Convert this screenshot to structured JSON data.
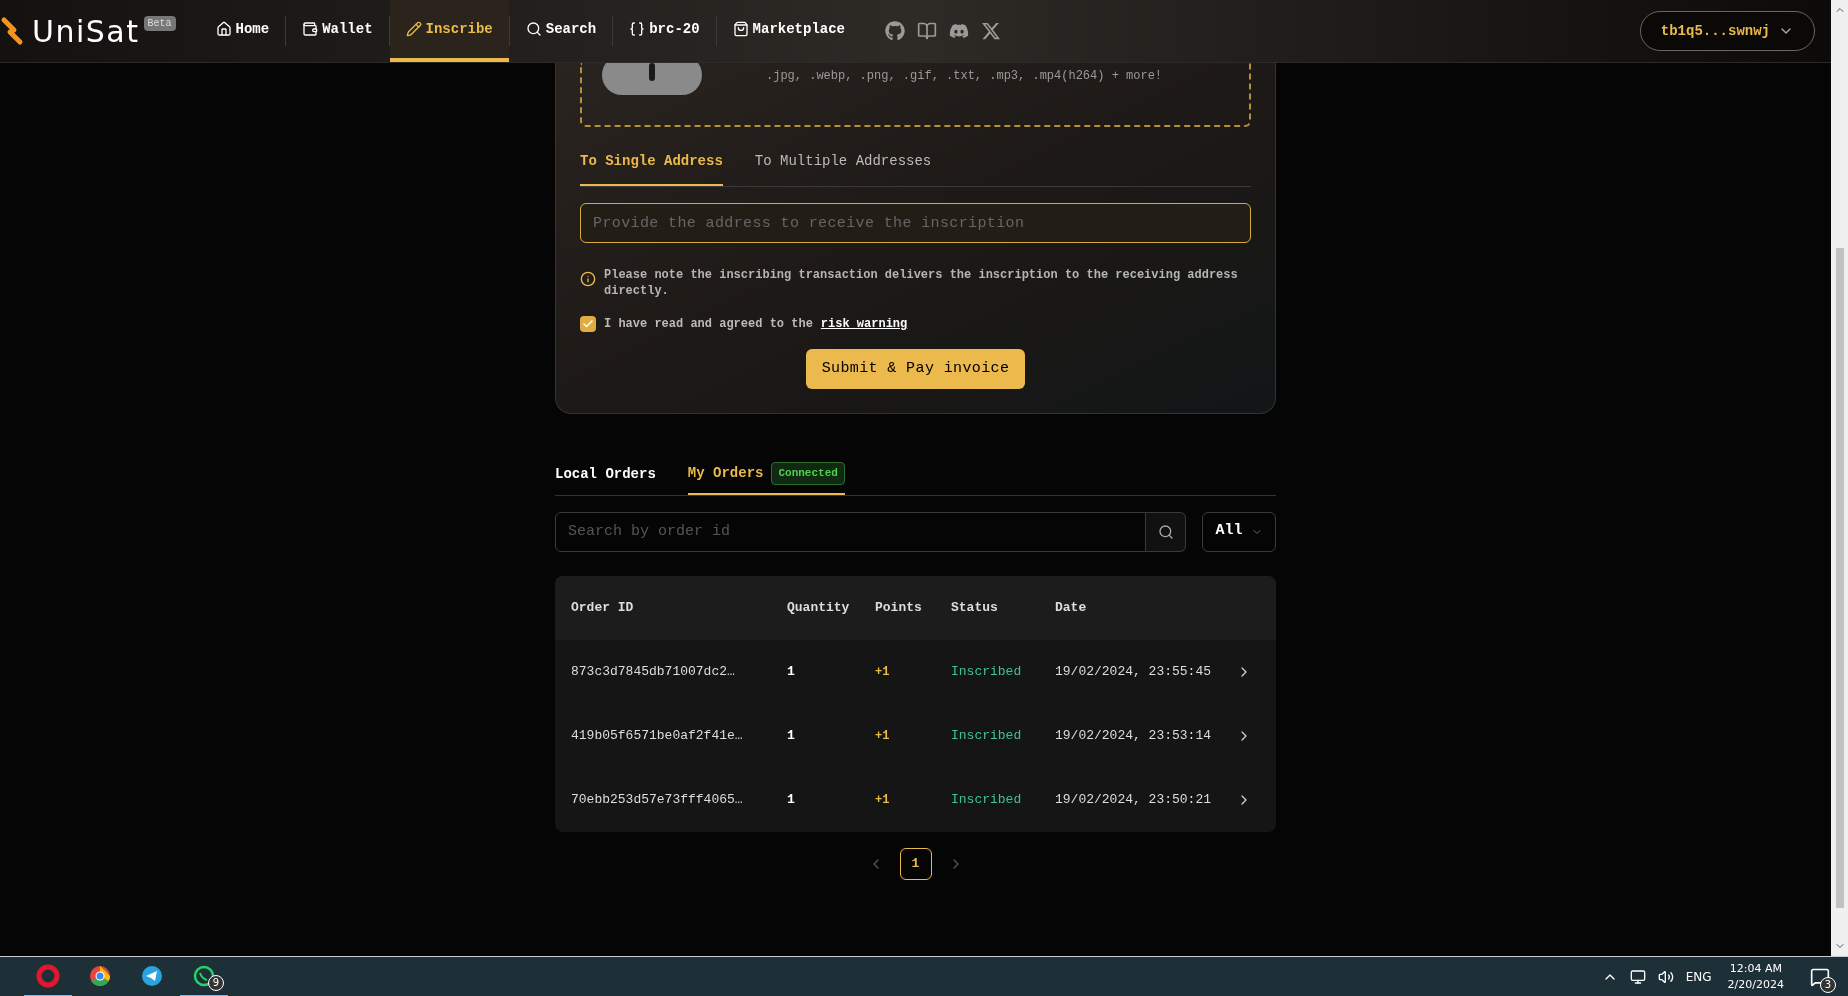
{
  "header": {
    "logo": "UniSat",
    "badge": "Beta",
    "nav": [
      {
        "kind": "home",
        "label": "Home",
        "selected": false
      },
      {
        "kind": "wallet",
        "label": "Wallet",
        "selected": false
      },
      {
        "kind": "inscribe",
        "label": "Inscribe",
        "selected": true
      },
      {
        "kind": "search",
        "label": "Search",
        "selected": false
      },
      {
        "kind": "brc",
        "label": "brc-20",
        "selected": false
      },
      {
        "kind": "market",
        "label": "Marketplace",
        "selected": false
      }
    ],
    "socials": [
      {
        "kind": "github"
      },
      {
        "kind": "book"
      },
      {
        "kind": "discord"
      },
      {
        "kind": "x"
      }
    ],
    "account": "tb1q5...swnwj"
  },
  "upload": {
    "formats": ".jpg, .webp, .png, .gif, .txt, .mp3, .mp4(h264) + more!"
  },
  "recipient_tabs": [
    {
      "label": "To Single Address",
      "selected": true
    },
    {
      "label": "To Multiple Addresses",
      "selected": false
    }
  ],
  "address_field": {
    "placeholder": "Provide the address to receive the inscription"
  },
  "note": "Please note the inscribing transaction delivers the inscription to the receiving address directly.",
  "agreement": {
    "text": "I have read and agreed to the",
    "link": "risk warning",
    "checked": true
  },
  "submit": "Submit & Pay invoice",
  "order_tabs": [
    {
      "label": "Local Orders",
      "selected": false
    },
    {
      "label": "My Orders",
      "selected": true,
      "badge": "Connected"
    }
  ],
  "order_search": {
    "placeholder": "Search by order id"
  },
  "filter": "All",
  "table": {
    "columns": [
      "Order ID",
      "Quantity",
      "Points",
      "Status",
      "Date"
    ],
    "rows": [
      {
        "id": "873c3d7845db71007dc2…",
        "quantity": "1",
        "points": "+1",
        "status": "Inscribed",
        "date": "19/02/2024, 23:55:45"
      },
      {
        "id": "419b05f6571be0af2f41e…",
        "quantity": "1",
        "points": "+1",
        "status": "Inscribed",
        "date": "19/02/2024, 23:53:14"
      },
      {
        "id": "70ebb253d57e73fff4065…",
        "quantity": "1",
        "points": "+1",
        "status": "Inscribed",
        "date": "19/02/2024, 23:50:21"
      }
    ]
  },
  "pagination": [
    {
      "label": "1",
      "selected": true
    }
  ],
  "taskbar": {
    "apps": [
      {
        "kind": "opera",
        "active": true
      },
      {
        "kind": "chrome",
        "active": false
      },
      {
        "kind": "telegram",
        "active": false
      },
      {
        "kind": "whatsapp",
        "active": true,
        "badge": "9"
      }
    ],
    "language": "ENG",
    "time": "12:04 AM",
    "date": "2/20/2024",
    "notifications": "3"
  }
}
